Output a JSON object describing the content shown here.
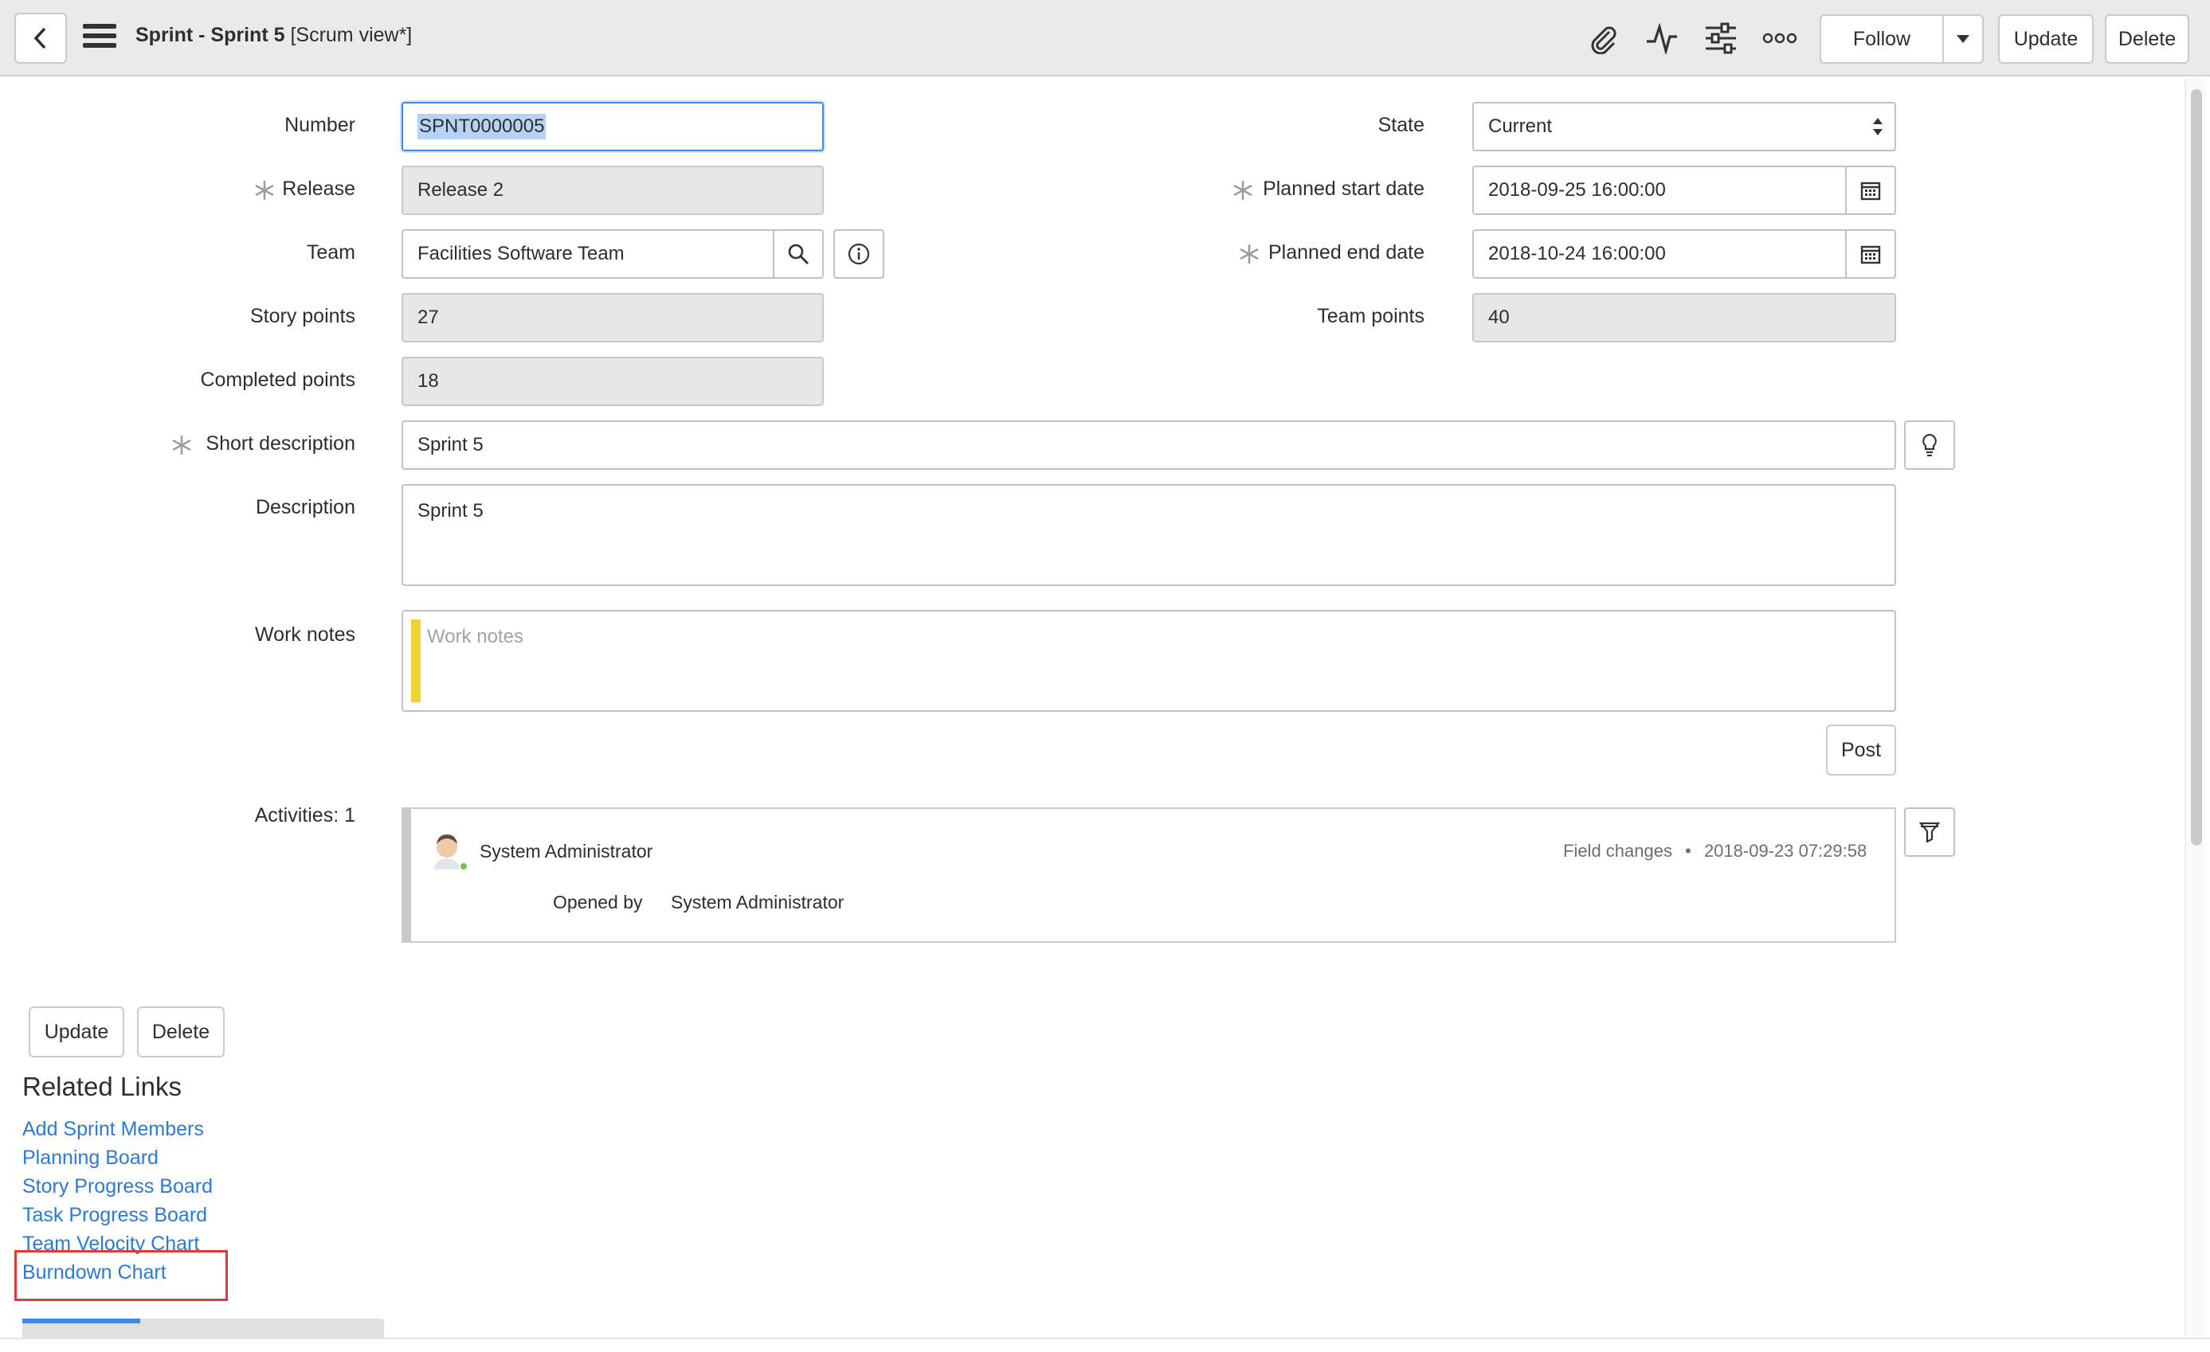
{
  "header": {
    "title_prefix": "Sprint - Sprint 5",
    "title_suffix": " [Scrum view*]",
    "follow_label": "Follow",
    "update_label": "Update",
    "delete_label": "Delete",
    "icons": [
      "back-arrow-icon",
      "hamburger-menu-icon",
      "paperclip-icon",
      "activity-pulse-icon",
      "settings-sliders-icon",
      "more-options-icon",
      "caret-down-icon"
    ]
  },
  "form": {
    "number": {
      "label": "Number",
      "value": "SPNT0000005"
    },
    "release": {
      "label": "Release",
      "value": "Release 2"
    },
    "team": {
      "label": "Team",
      "value": "Facilities Software Team"
    },
    "story_points": {
      "label": "Story points",
      "value": "27"
    },
    "completed_points": {
      "label": "Completed points",
      "value": "18"
    },
    "state": {
      "label": "State",
      "value": "Current"
    },
    "planned_start": {
      "label": "Planned start date",
      "value": "2018-09-25 16:00:00"
    },
    "planned_end": {
      "label": "Planned end date",
      "value": "2018-10-24 16:00:00"
    },
    "team_points": {
      "label": "Team points",
      "value": "40"
    },
    "short_description": {
      "label": "Short description",
      "value": "Sprint 5"
    },
    "description": {
      "label": "Description",
      "value": "Sprint 5"
    },
    "work_notes": {
      "label": "Work notes",
      "placeholder": "Work notes"
    },
    "post_label": "Post"
  },
  "activities": {
    "label": "Activities: 1",
    "entry": {
      "user": "System Administrator",
      "type": "Field changes",
      "separator": "•",
      "timestamp": "2018-09-23 07:29:58",
      "field": "Opened by",
      "value": "System Administrator"
    }
  },
  "footer_buttons": {
    "update_label": "Update",
    "delete_label": "Delete"
  },
  "related_links": {
    "title": "Related Links",
    "items": [
      "Add Sprint Members",
      "Planning Board",
      "Story Progress Board",
      "Task Progress Board",
      "Team Velocity Chart",
      "Burndown Chart"
    ]
  },
  "colors": {
    "link": "#2b7bd6",
    "focus": "#3c8ce7",
    "work_notes_accent": "#f2d233",
    "highlight": "#e53935",
    "online": "#71c34b"
  }
}
